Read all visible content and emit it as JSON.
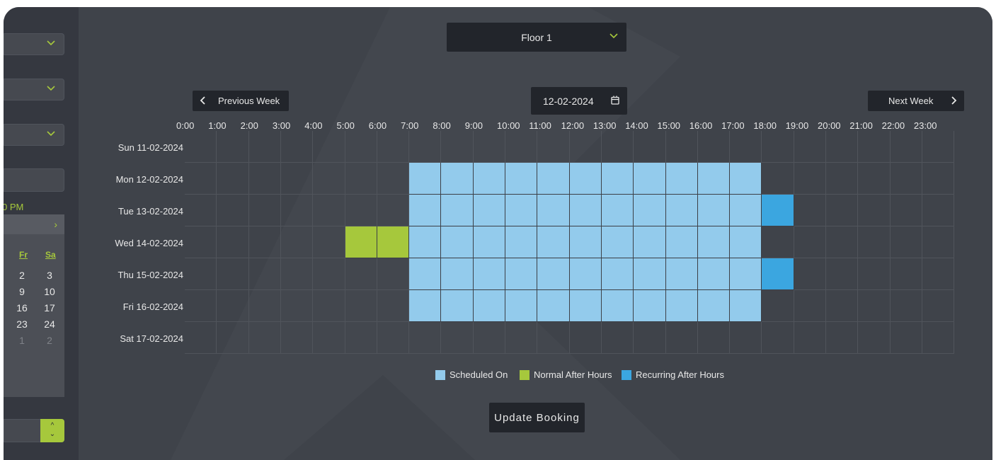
{
  "sidebar": {
    "time_text": "0 PM",
    "calendar": {
      "next_glyph": "›",
      "dow": [
        "Fr",
        "Sa"
      ],
      "weeks": [
        [
          "2",
          "3"
        ],
        [
          "9",
          "10"
        ],
        [
          "16",
          "17"
        ],
        [
          "23",
          "24"
        ],
        [
          "1",
          "2"
        ]
      ]
    },
    "stepper": {
      "up": "^",
      "down": "⌄"
    }
  },
  "header": {
    "floor_select_value": "Floor 1",
    "prev_week_label": "Previous Week",
    "next_week_label": "Next Week",
    "date_value": "12-02-2024"
  },
  "schedule": {
    "hours": [
      "0:00",
      "1:00",
      "2:00",
      "3:00",
      "4:00",
      "5:00",
      "6:00",
      "7:00",
      "8:00",
      "9:00",
      "10:00",
      "11:00",
      "12:00",
      "13:00",
      "14:00",
      "15:00",
      "16:00",
      "17:00",
      "18:00",
      "19:00",
      "20:00",
      "21:00",
      "22:00",
      "23:00"
    ],
    "days": [
      "Sun 11-02-2024",
      "Mon 12-02-2024",
      "Tue 13-02-2024",
      "Wed 14-02-2024",
      "Thu 15-02-2024",
      "Fri 16-02-2024",
      "Sat 17-02-2024"
    ],
    "cells": [
      [],
      [
        {
          "from": 7,
          "to": 18,
          "type": "sched"
        }
      ],
      [
        {
          "from": 7,
          "to": 18,
          "type": "sched"
        },
        {
          "from": 18,
          "to": 19,
          "type": "recur"
        }
      ],
      [
        {
          "from": 5,
          "to": 7,
          "type": "normal"
        },
        {
          "from": 7,
          "to": 18,
          "type": "sched"
        }
      ],
      [
        {
          "from": 7,
          "to": 18,
          "type": "sched"
        },
        {
          "from": 18,
          "to": 19,
          "type": "recur"
        }
      ],
      [
        {
          "from": 7,
          "to": 18,
          "type": "sched"
        }
      ],
      []
    ]
  },
  "legend": [
    {
      "label": "Scheduled On",
      "color": "#93cbec"
    },
    {
      "label": "Normal After Hours",
      "color": "#a6c83c"
    },
    {
      "label": "Recurring After Hours",
      "color": "#3ba6e0"
    }
  ],
  "actions": {
    "update_label": "Update Booking"
  },
  "colors": {
    "accent": "#a6c83c",
    "scheduled": "#93cbec",
    "recurring": "#3ba6e0",
    "dark_control": "#22252b"
  }
}
